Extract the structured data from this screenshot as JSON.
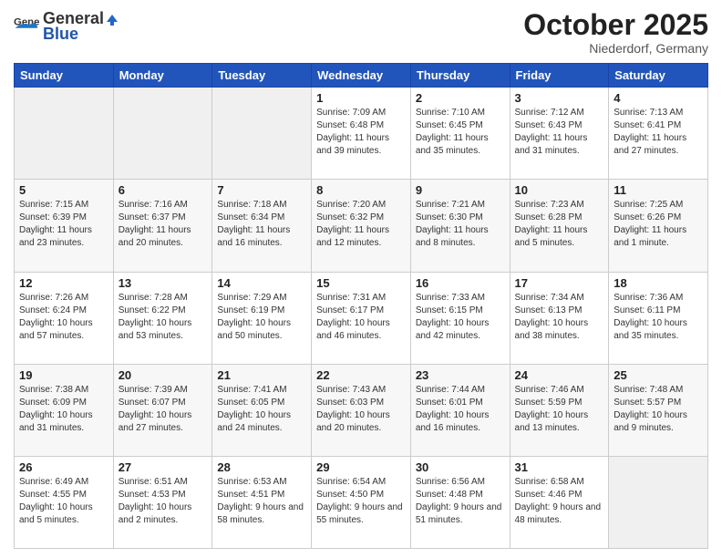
{
  "header": {
    "logo_general": "General",
    "logo_blue": "Blue",
    "month": "October 2025",
    "location": "Niederdorf, Germany"
  },
  "days_of_week": [
    "Sunday",
    "Monday",
    "Tuesday",
    "Wednesday",
    "Thursday",
    "Friday",
    "Saturday"
  ],
  "weeks": [
    [
      {
        "day": "",
        "sunrise": "",
        "sunset": "",
        "daylight": ""
      },
      {
        "day": "",
        "sunrise": "",
        "sunset": "",
        "daylight": ""
      },
      {
        "day": "",
        "sunrise": "",
        "sunset": "",
        "daylight": ""
      },
      {
        "day": "1",
        "sunrise": "Sunrise: 7:09 AM",
        "sunset": "Sunset: 6:48 PM",
        "daylight": "Daylight: 11 hours and 39 minutes."
      },
      {
        "day": "2",
        "sunrise": "Sunrise: 7:10 AM",
        "sunset": "Sunset: 6:45 PM",
        "daylight": "Daylight: 11 hours and 35 minutes."
      },
      {
        "day": "3",
        "sunrise": "Sunrise: 7:12 AM",
        "sunset": "Sunset: 6:43 PM",
        "daylight": "Daylight: 11 hours and 31 minutes."
      },
      {
        "day": "4",
        "sunrise": "Sunrise: 7:13 AM",
        "sunset": "Sunset: 6:41 PM",
        "daylight": "Daylight: 11 hours and 27 minutes."
      }
    ],
    [
      {
        "day": "5",
        "sunrise": "Sunrise: 7:15 AM",
        "sunset": "Sunset: 6:39 PM",
        "daylight": "Daylight: 11 hours and 23 minutes."
      },
      {
        "day": "6",
        "sunrise": "Sunrise: 7:16 AM",
        "sunset": "Sunset: 6:37 PM",
        "daylight": "Daylight: 11 hours and 20 minutes."
      },
      {
        "day": "7",
        "sunrise": "Sunrise: 7:18 AM",
        "sunset": "Sunset: 6:34 PM",
        "daylight": "Daylight: 11 hours and 16 minutes."
      },
      {
        "day": "8",
        "sunrise": "Sunrise: 7:20 AM",
        "sunset": "Sunset: 6:32 PM",
        "daylight": "Daylight: 11 hours and 12 minutes."
      },
      {
        "day": "9",
        "sunrise": "Sunrise: 7:21 AM",
        "sunset": "Sunset: 6:30 PM",
        "daylight": "Daylight: 11 hours and 8 minutes."
      },
      {
        "day": "10",
        "sunrise": "Sunrise: 7:23 AM",
        "sunset": "Sunset: 6:28 PM",
        "daylight": "Daylight: 11 hours and 5 minutes."
      },
      {
        "day": "11",
        "sunrise": "Sunrise: 7:25 AM",
        "sunset": "Sunset: 6:26 PM",
        "daylight": "Daylight: 11 hours and 1 minute."
      }
    ],
    [
      {
        "day": "12",
        "sunrise": "Sunrise: 7:26 AM",
        "sunset": "Sunset: 6:24 PM",
        "daylight": "Daylight: 10 hours and 57 minutes."
      },
      {
        "day": "13",
        "sunrise": "Sunrise: 7:28 AM",
        "sunset": "Sunset: 6:22 PM",
        "daylight": "Daylight: 10 hours and 53 minutes."
      },
      {
        "day": "14",
        "sunrise": "Sunrise: 7:29 AM",
        "sunset": "Sunset: 6:19 PM",
        "daylight": "Daylight: 10 hours and 50 minutes."
      },
      {
        "day": "15",
        "sunrise": "Sunrise: 7:31 AM",
        "sunset": "Sunset: 6:17 PM",
        "daylight": "Daylight: 10 hours and 46 minutes."
      },
      {
        "day": "16",
        "sunrise": "Sunrise: 7:33 AM",
        "sunset": "Sunset: 6:15 PM",
        "daylight": "Daylight: 10 hours and 42 minutes."
      },
      {
        "day": "17",
        "sunrise": "Sunrise: 7:34 AM",
        "sunset": "Sunset: 6:13 PM",
        "daylight": "Daylight: 10 hours and 38 minutes."
      },
      {
        "day": "18",
        "sunrise": "Sunrise: 7:36 AM",
        "sunset": "Sunset: 6:11 PM",
        "daylight": "Daylight: 10 hours and 35 minutes."
      }
    ],
    [
      {
        "day": "19",
        "sunrise": "Sunrise: 7:38 AM",
        "sunset": "Sunset: 6:09 PM",
        "daylight": "Daylight: 10 hours and 31 minutes."
      },
      {
        "day": "20",
        "sunrise": "Sunrise: 7:39 AM",
        "sunset": "Sunset: 6:07 PM",
        "daylight": "Daylight: 10 hours and 27 minutes."
      },
      {
        "day": "21",
        "sunrise": "Sunrise: 7:41 AM",
        "sunset": "Sunset: 6:05 PM",
        "daylight": "Daylight: 10 hours and 24 minutes."
      },
      {
        "day": "22",
        "sunrise": "Sunrise: 7:43 AM",
        "sunset": "Sunset: 6:03 PM",
        "daylight": "Daylight: 10 hours and 20 minutes."
      },
      {
        "day": "23",
        "sunrise": "Sunrise: 7:44 AM",
        "sunset": "Sunset: 6:01 PM",
        "daylight": "Daylight: 10 hours and 16 minutes."
      },
      {
        "day": "24",
        "sunrise": "Sunrise: 7:46 AM",
        "sunset": "Sunset: 5:59 PM",
        "daylight": "Daylight: 10 hours and 13 minutes."
      },
      {
        "day": "25",
        "sunrise": "Sunrise: 7:48 AM",
        "sunset": "Sunset: 5:57 PM",
        "daylight": "Daylight: 10 hours and 9 minutes."
      }
    ],
    [
      {
        "day": "26",
        "sunrise": "Sunrise: 6:49 AM",
        "sunset": "Sunset: 4:55 PM",
        "daylight": "Daylight: 10 hours and 5 minutes."
      },
      {
        "day": "27",
        "sunrise": "Sunrise: 6:51 AM",
        "sunset": "Sunset: 4:53 PM",
        "daylight": "Daylight: 10 hours and 2 minutes."
      },
      {
        "day": "28",
        "sunrise": "Sunrise: 6:53 AM",
        "sunset": "Sunset: 4:51 PM",
        "daylight": "Daylight: 9 hours and 58 minutes."
      },
      {
        "day": "29",
        "sunrise": "Sunrise: 6:54 AM",
        "sunset": "Sunset: 4:50 PM",
        "daylight": "Daylight: 9 hours and 55 minutes."
      },
      {
        "day": "30",
        "sunrise": "Sunrise: 6:56 AM",
        "sunset": "Sunset: 4:48 PM",
        "daylight": "Daylight: 9 hours and 51 minutes."
      },
      {
        "day": "31",
        "sunrise": "Sunrise: 6:58 AM",
        "sunset": "Sunset: 4:46 PM",
        "daylight": "Daylight: 9 hours and 48 minutes."
      },
      {
        "day": "",
        "sunrise": "",
        "sunset": "",
        "daylight": ""
      }
    ]
  ]
}
